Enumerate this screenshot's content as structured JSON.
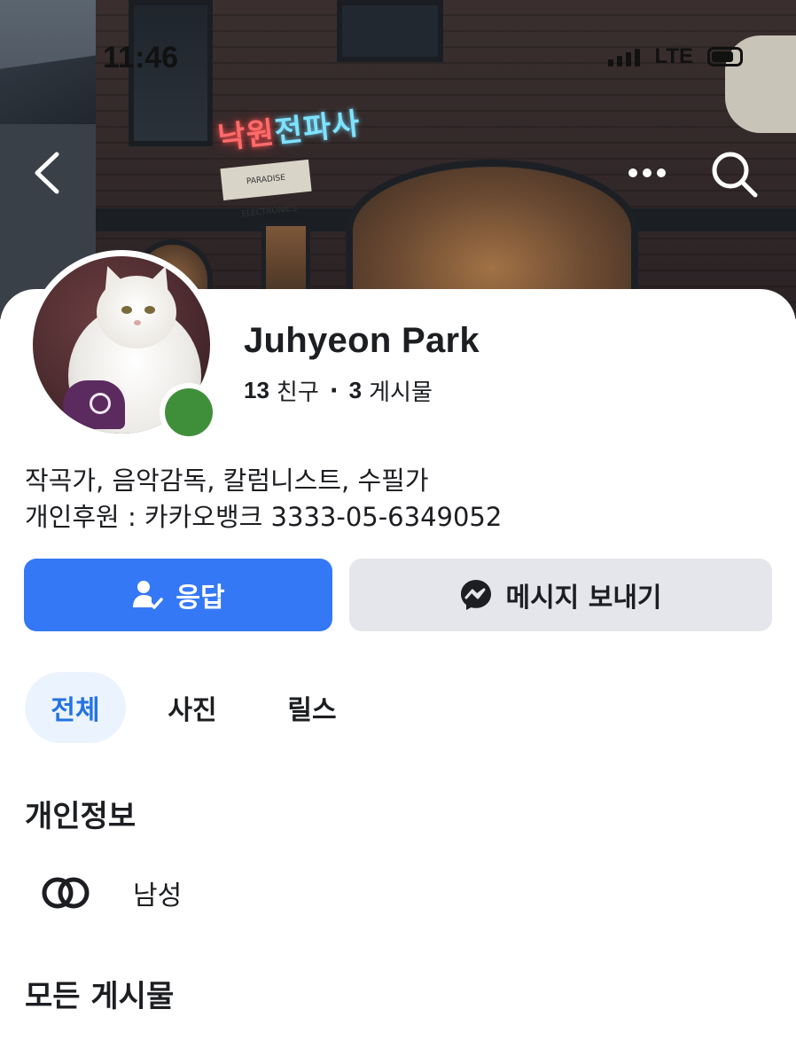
{
  "status_bar": {
    "time": "11:46",
    "network": "LTE"
  },
  "cover": {
    "neon_sign_a": "낙원",
    "neon_sign_b": "전파사",
    "board_sign": "PARADISE ELECTRONICS"
  },
  "profile": {
    "name": "Juhyeon Park",
    "friends_count": "13",
    "friends_label": "친구",
    "separator": "·",
    "posts_count": "3",
    "posts_label": "게시물",
    "online_color": "#3f8f3a",
    "bio_line1": "작곡가, 음악감독, 칼럼니스트, 수필가",
    "bio_line2": "개인후원 : 카카오뱅크 3333-05-6349052"
  },
  "actions": {
    "respond_label": "응답",
    "message_label": "메시지 보내기",
    "respond_color": "#3578f6",
    "message_color": "#e4e6eb"
  },
  "tabs": [
    {
      "label": "전체",
      "active": true
    },
    {
      "label": "사진",
      "active": false
    },
    {
      "label": "릴스",
      "active": false
    }
  ],
  "personal_info": {
    "title": "개인정보",
    "gender_icon": "gender-rings-icon",
    "gender": "남성"
  },
  "all_posts": {
    "title": "모든 게시물"
  }
}
